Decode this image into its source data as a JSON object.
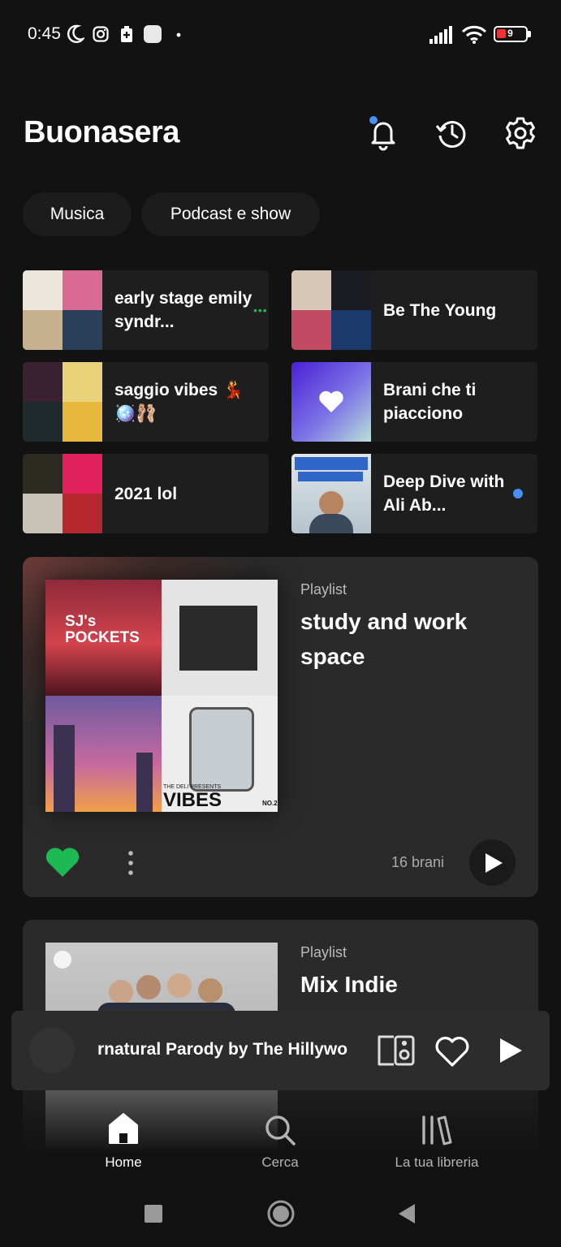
{
  "status_bar": {
    "time": "0:45",
    "battery_level": "9",
    "icons": [
      "moon-icon",
      "instagram-icon",
      "battery-saver-icon",
      "app-icon",
      "dot-icon",
      "signal-icon",
      "wifi-icon",
      "battery-icon"
    ]
  },
  "header": {
    "greeting": "Buonasera",
    "icons": [
      "bell-icon",
      "history-icon",
      "gear-icon"
    ]
  },
  "filters": [
    "Musica",
    "Podcast e show"
  ],
  "shortcuts": [
    {
      "title": "early stage emily syndr..."
    },
    {
      "title": "Be The Young"
    },
    {
      "title": "saggio vibes 💃 🪩🩰"
    },
    {
      "title": "Brani che ti piacciono"
    },
    {
      "title": "2021 lol"
    },
    {
      "title": "Deep Dive with Ali Ab..."
    }
  ],
  "card": {
    "type": "Playlist",
    "title": "study and work space",
    "count": "16 brani",
    "art_texts": [
      "SJ's POCKETS",
      "THE DELI PRESENTS",
      "VIBES",
      "NO.2"
    ]
  },
  "card2": {
    "type": "Playlist",
    "title": "Mix Indie"
  },
  "mini_player": {
    "track": "rnatural Parody by The Hillywo"
  },
  "nav": {
    "home": "Home",
    "search": "Cerca",
    "library": "La tua libreria"
  },
  "colors": {
    "background": "#121212",
    "accent_green": "#1db954",
    "notification_blue": "#4a8ff5"
  }
}
